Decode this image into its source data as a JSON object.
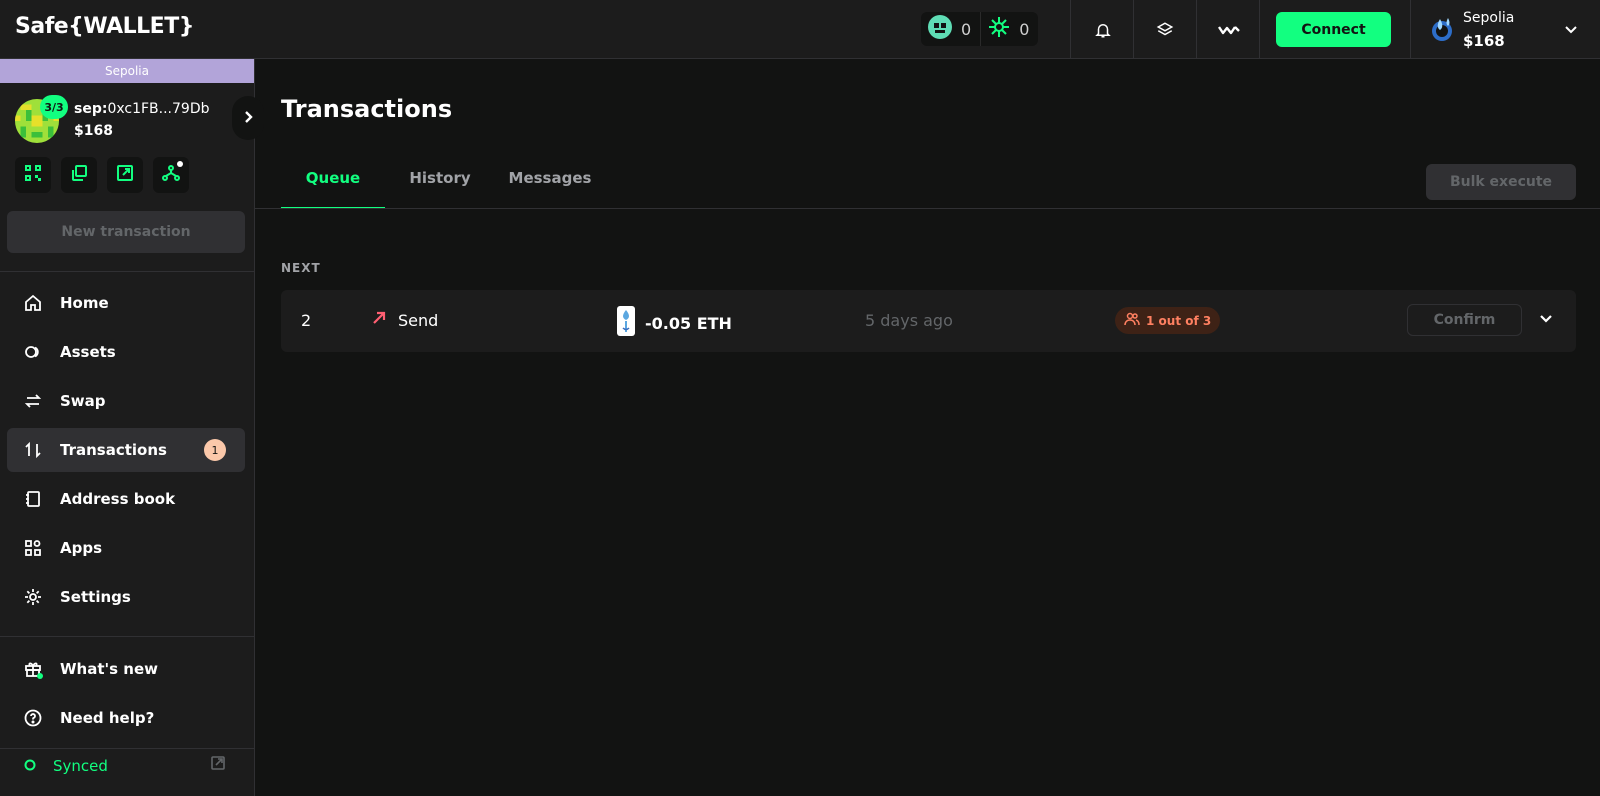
{
  "app": {
    "logo": "Safe{WALLET}"
  },
  "header": {
    "counters": [
      {
        "icon": "safe-pass-icon",
        "value": "0"
      },
      {
        "icon": "spark-icon",
        "value": "0"
      }
    ],
    "icons": [
      "bell-icon",
      "layers-icon",
      "walletconnect-icon"
    ],
    "connect_label": "Connect",
    "network": {
      "name": "Sepolia",
      "balance": "$168"
    }
  },
  "sidebar": {
    "chain": "Sepolia",
    "safe": {
      "threshold": "3/3",
      "prefix": "sep:",
      "address": "0xc1FB...79Db",
      "balance": "$168"
    },
    "new_tx_label": "New transaction",
    "nav": [
      {
        "label": "Home",
        "icon": "home-icon"
      },
      {
        "label": "Assets",
        "icon": "assets-icon"
      },
      {
        "label": "Swap",
        "icon": "swap-icon"
      },
      {
        "label": "Transactions",
        "icon": "transactions-icon",
        "badge": "1"
      },
      {
        "label": "Address book",
        "icon": "address-book-icon"
      },
      {
        "label": "Apps",
        "icon": "apps-icon"
      },
      {
        "label": "Settings",
        "icon": "settings-icon"
      }
    ],
    "footer_nav": [
      {
        "label": "What's new",
        "icon": "gift-icon"
      },
      {
        "label": "Need help?",
        "icon": "help-icon"
      }
    ],
    "status": "Synced"
  },
  "main": {
    "title": "Transactions",
    "tabs": [
      {
        "label": "Queue"
      },
      {
        "label": "History"
      },
      {
        "label": "Messages"
      }
    ],
    "bulk_label": "Bulk execute",
    "section_label": "NEXT",
    "transactions": [
      {
        "nonce": "2",
        "type": "Send",
        "amount": "-0.05 ETH",
        "time": "5 days ago",
        "status": "1 out of 3",
        "confirm_label": "Confirm"
      }
    ]
  },
  "colors": {
    "accent": "#12ff80",
    "background": "#121312",
    "panel": "#1c1c1c",
    "warning": "#ff8061",
    "badge": "#fbc8aa",
    "chain_strip": "#b2a4d9"
  }
}
